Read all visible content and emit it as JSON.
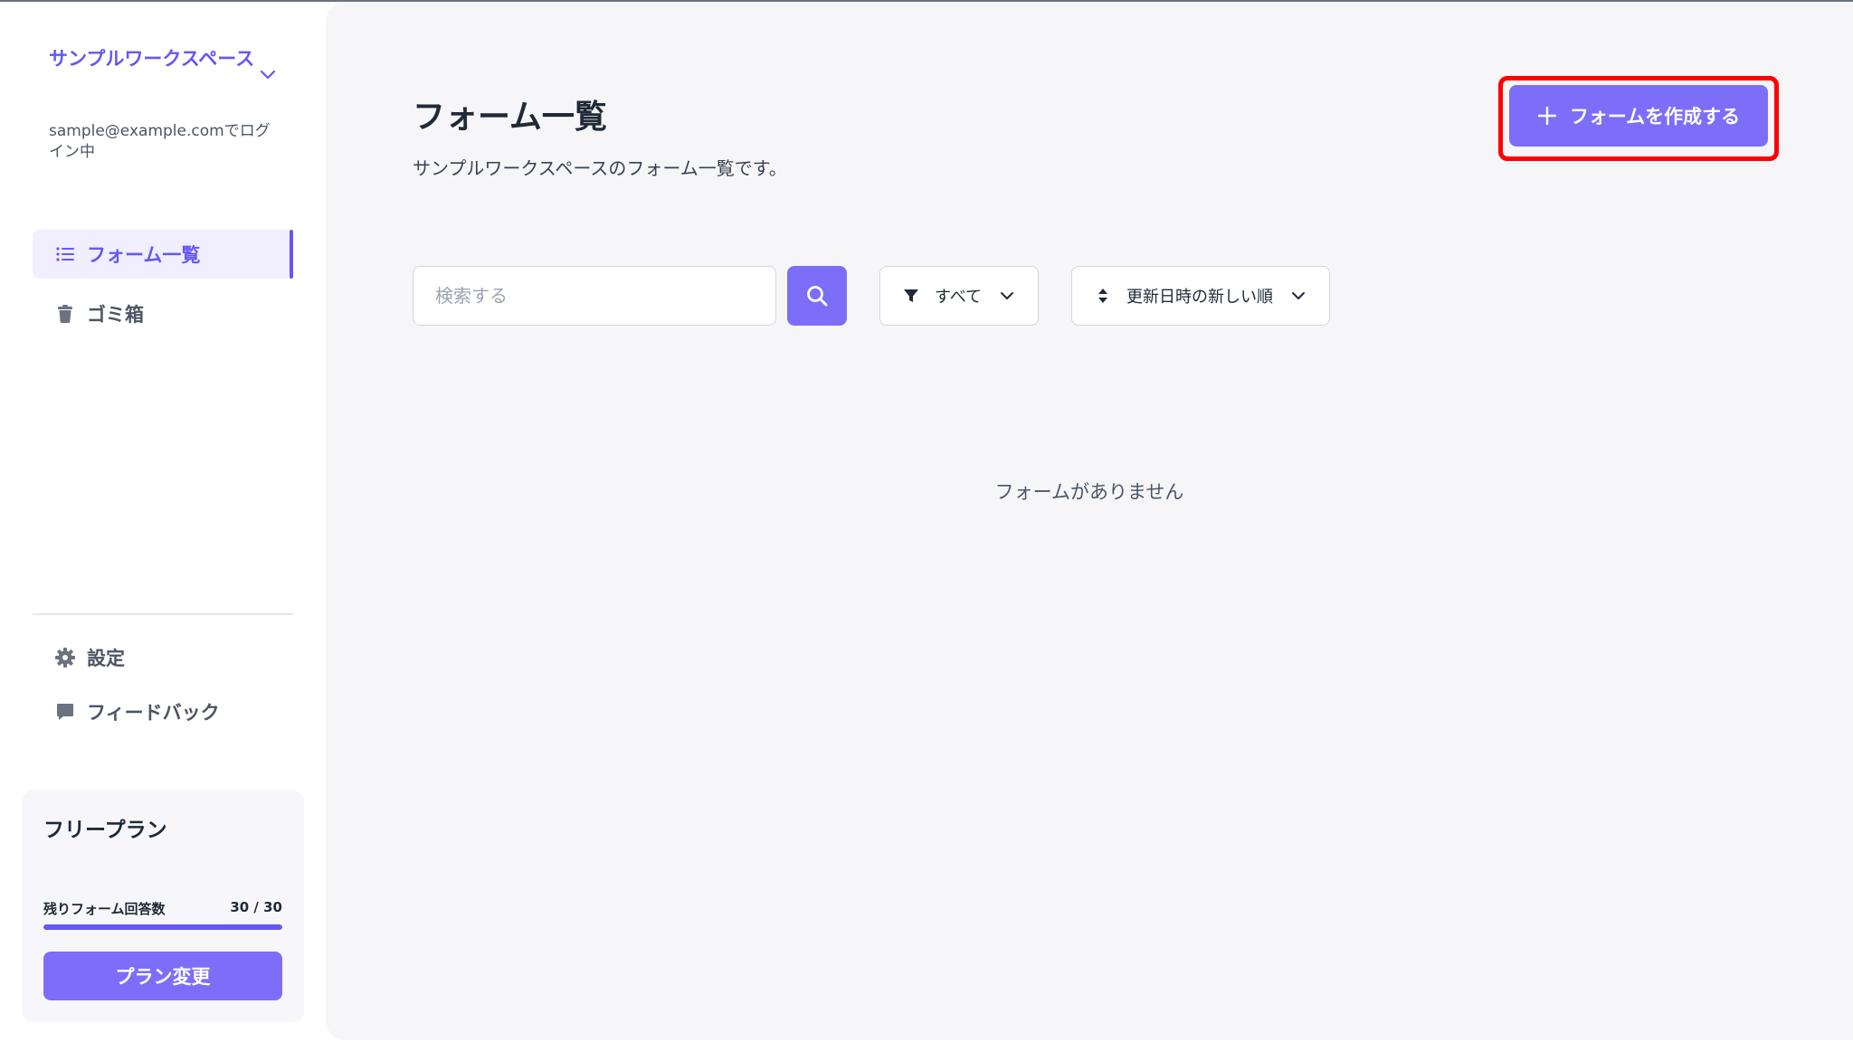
{
  "sidebar": {
    "workspace_name": "サンプルワークスペース",
    "login_text": "sample@example.comでログイン中",
    "nav": [
      {
        "label": "フォーム一覧",
        "icon": "list-icon",
        "active": true
      },
      {
        "label": "ゴミ箱",
        "icon": "trash-icon",
        "active": false
      }
    ],
    "bottom": [
      {
        "label": "設定",
        "icon": "gear-icon"
      },
      {
        "label": "フィードバック",
        "icon": "chat-bubble-icon"
      }
    ],
    "plan": {
      "title": "フリープラン",
      "usage_label": "残りフォーム回答数",
      "usage_count": "30 / 30",
      "usage_fraction": 1.0,
      "button_label": "プラン変更"
    }
  },
  "main": {
    "title": "フォーム一覧",
    "description": "サンプルワークスペースのフォーム一覧です。",
    "create_button_label": "フォームを作成する",
    "search": {
      "placeholder": "検索する",
      "value": ""
    },
    "filter": {
      "label": "すべて",
      "icon": "filter-icon"
    },
    "sort": {
      "label": "更新日時の新しい順",
      "icon": "sort-icon"
    },
    "empty_message": "フォームがありません"
  },
  "colors": {
    "accent": "#6557f5",
    "button": "#7c6ef8",
    "highlight": "#ff0000",
    "main_bg": "#f6f6f9"
  }
}
